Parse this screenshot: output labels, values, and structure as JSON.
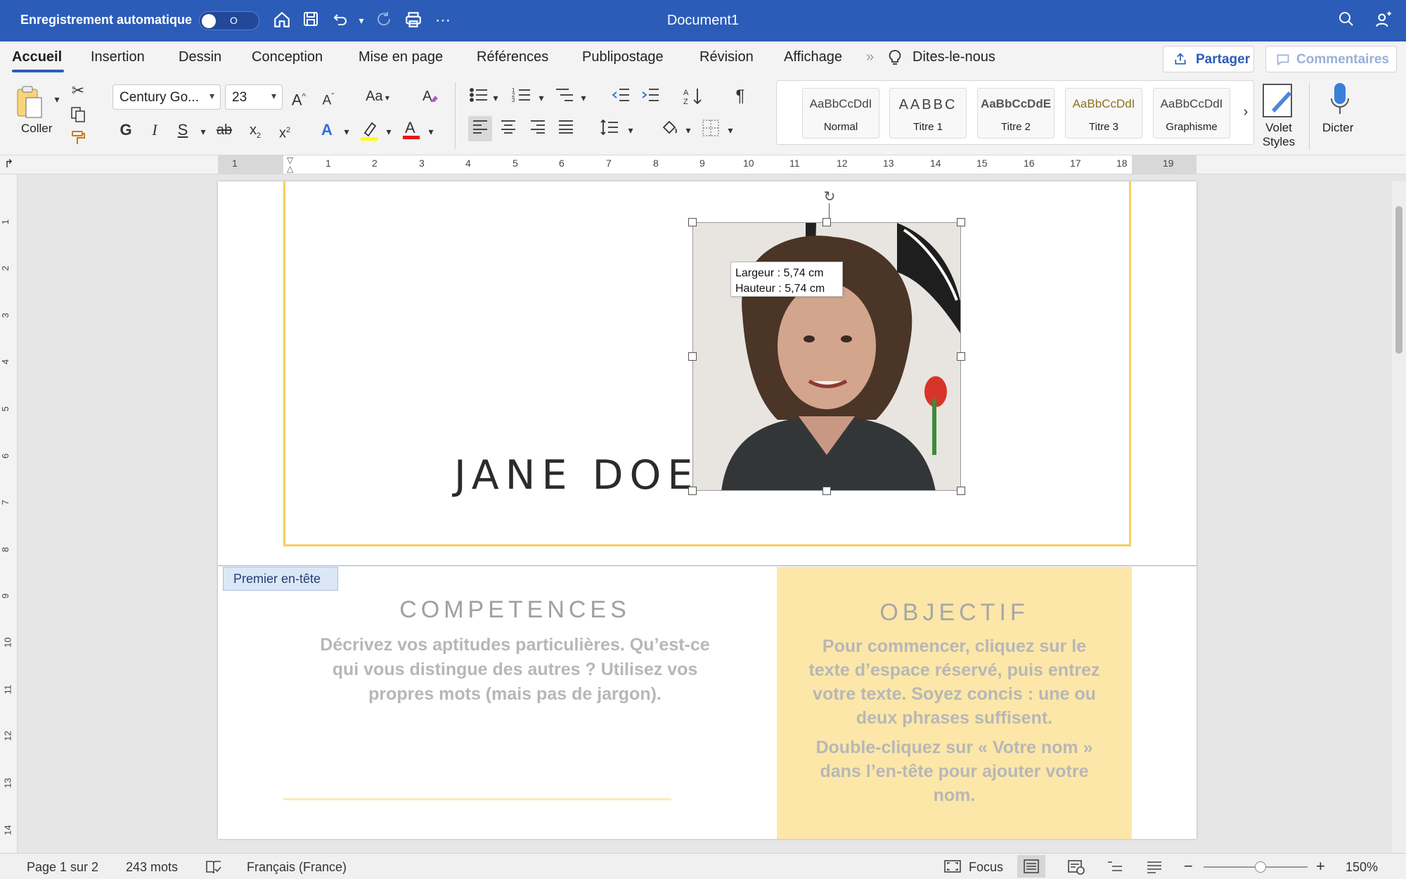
{
  "titlebar": {
    "autosave_label": "Enregistrement automatique",
    "autosave_state": "O",
    "doc_title": "Document1",
    "icons": [
      "home-icon",
      "save-icon",
      "undo-icon",
      "undo-dropdown-icon",
      "redo-icon",
      "print-icon",
      "more-icon",
      "search-icon",
      "share-people-icon"
    ]
  },
  "tabs": {
    "items": [
      "Accueil",
      "Insertion",
      "Dessin",
      "Conception",
      "Mise en page",
      "Références",
      "Publipostage",
      "Révision",
      "Affichage"
    ],
    "tell_me": "Dites-le-nous",
    "share": "Partager",
    "comments": "Commentaires"
  },
  "ribbon": {
    "paste_label": "Coller",
    "font_name": "Century Go...",
    "font_size": "23",
    "styles": [
      {
        "sample": "AaBbCcDdI",
        "name": "Normal"
      },
      {
        "sample": "AABBC",
        "name": "Titre 1"
      },
      {
        "sample": "AaBbCcDdE",
        "name": "Titre 2"
      },
      {
        "sample": "AaBbCcDdI",
        "name": "Titre 3"
      },
      {
        "sample": "AaBbCcDdI",
        "name": "Graphisme"
      }
    ],
    "styles_pane_label": "Volet\nStyles",
    "dictate_label": "Dicter",
    "accent_color": "#2b5cb8",
    "highlight_color": "#ffff00",
    "font_color": "#e8141c"
  },
  "ruler": {
    "numbers": [
      "1",
      "1",
      "2",
      "3",
      "4",
      "5",
      "6",
      "7",
      "8",
      "9",
      "10",
      "11",
      "12",
      "13",
      "14",
      "15",
      "16",
      "17",
      "18",
      "19"
    ],
    "vnumbers": [
      "1",
      "2",
      "3",
      "4",
      "5",
      "6",
      "7",
      "8",
      "9",
      "10",
      "11",
      "12",
      "13",
      "14"
    ]
  },
  "document": {
    "name": "JANE DOE",
    "tooltip_width": "Largeur : 5,74 cm",
    "tooltip_height": "Hauteur : 5,74 cm",
    "header_tag": "Premier en-tête",
    "competences_title": "COMPETENCES",
    "competences_body": "Décrivez vos aptitudes particulières. Qu’est-ce qui vous distingue des autres ? Utilisez vos propres mots (mais pas de jargon).",
    "objectif_title": "OBJECTIF",
    "objectif_body_1": "Pour commencer, cliquez sur le texte d’espace réservé, puis entrez votre texte. Soyez concis : une ou deux phrases suffisent.",
    "objectif_body_2": "Double-cliquez sur « Votre nom » dans l’en-tête pour ajouter votre nom.",
    "frame_color": "#f4cf5f",
    "objectif_bg": "#fce7a9"
  },
  "statusbar": {
    "page": "Page 1 sur 2",
    "words": "243 mots",
    "language": "Français (France)",
    "focus": "Focus",
    "zoom": "150%",
    "zoom_minus": "−",
    "zoom_plus": "+"
  }
}
